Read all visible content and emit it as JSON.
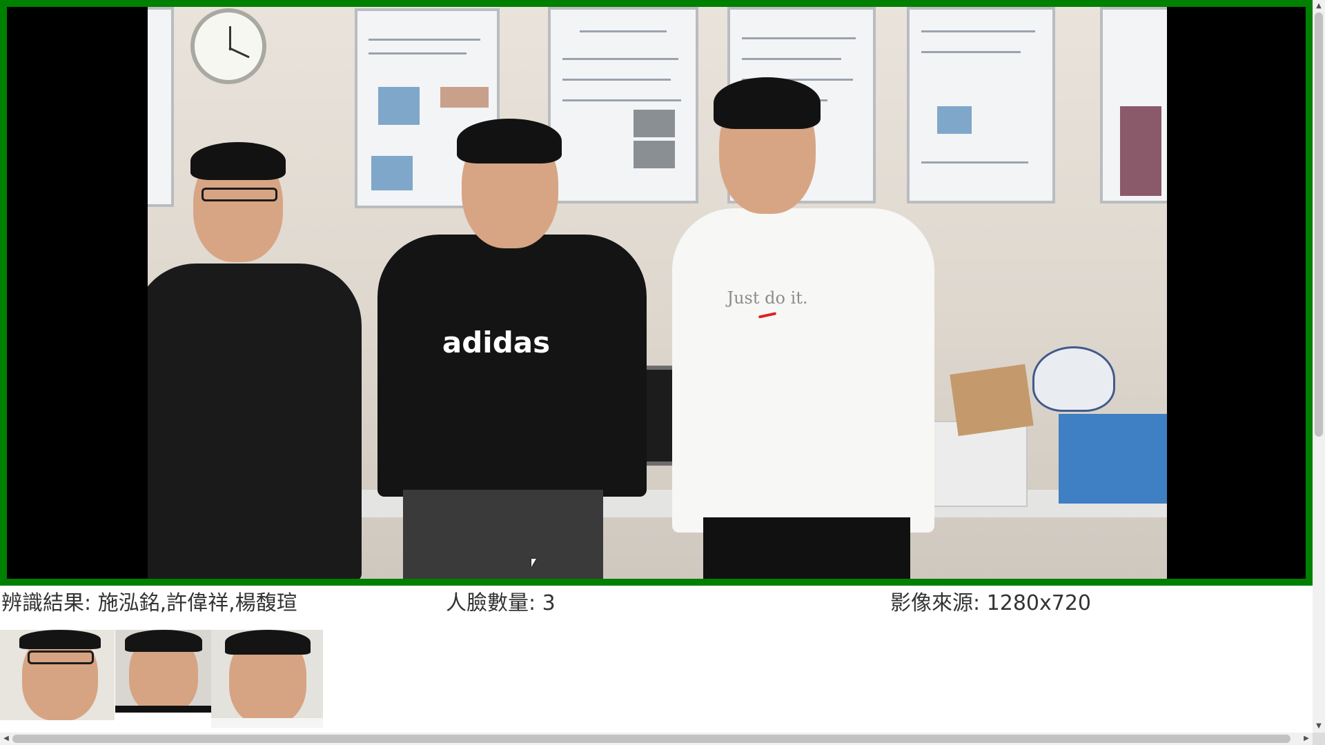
{
  "recognition": {
    "result_label": "辨識結果: 施泓銘,許偉祥,楊馥瑄",
    "face_count_label": "人臉數量: 3",
    "source_label": "影像來源: 1280x720"
  },
  "camera": {
    "shirt_texts": [
      "adidas",
      "Just do it."
    ]
  },
  "thumbnails": [
    {
      "name": "face-thumbnail-1"
    },
    {
      "name": "face-thumbnail-2"
    },
    {
      "name": "face-thumbnail-3"
    }
  ],
  "colors": {
    "frame_border": "#008000",
    "letterbox": "#000000",
    "text": "#333333",
    "scrollbar_track": "#f1f1f1",
    "scrollbar_thumb": "#c1c1c1"
  },
  "icons": {
    "scroll_up": "▲",
    "scroll_down": "▼",
    "scroll_left": "◀",
    "scroll_right": "▶",
    "cursor": "mouse-pointer-icon"
  }
}
